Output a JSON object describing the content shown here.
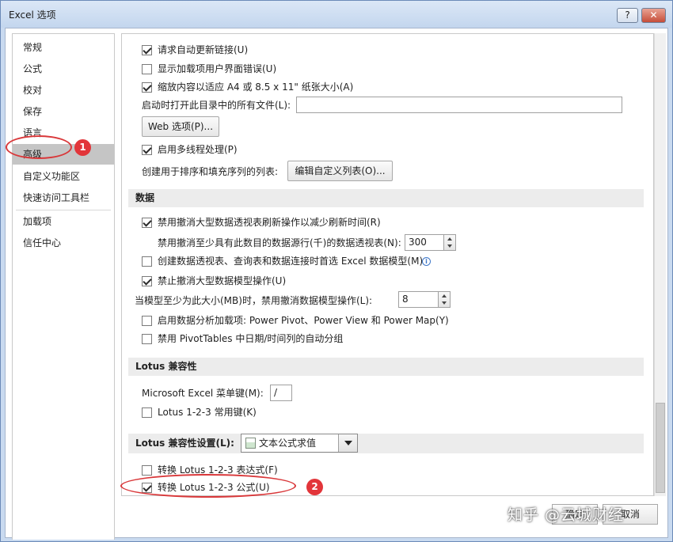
{
  "window": {
    "title": "Excel 选项",
    "help_label": "?",
    "close_label": "✕"
  },
  "nav": {
    "items": [
      "常规",
      "公式",
      "校对",
      "保存",
      "语言",
      "高级",
      "自定义功能区",
      "快速访问工具栏",
      "加载项",
      "信任中心"
    ],
    "selected": "高级"
  },
  "annotations": {
    "num1": "1",
    "num2": "2"
  },
  "general": {
    "auto_update_links": {
      "label": "请求自动更新链接(U)",
      "checked": true
    },
    "addin_ui_errors": {
      "label": "显示加载项用户界面错误(U)",
      "checked": false
    },
    "scale_to_a4": {
      "label": "缩放内容以适应 A4 或 8.5 x 11\" 纸张大小(A)",
      "checked": true
    },
    "startup_open_label": "启动时打开此目录中的所有文件(L):",
    "startup_open_value": "",
    "web_options_label": "Web 选项(P)...",
    "multithread": {
      "label": "启用多线程处理(P)",
      "checked": true
    },
    "sort_fill_label": "创建用于排序和填充序列的列表:",
    "edit_custom_lists_label": "编辑自定义列表(O)..."
  },
  "data_section": {
    "header": "数据",
    "disable_undo_pivot": {
      "label": "禁用撤消大型数据透视表刷新操作以减少刷新时间(R)",
      "checked": true
    },
    "pivot_rows_label": "禁用撤消至少具有此数目的数据源行(千)的数据透视表(N):",
    "pivot_rows_value": "300",
    "create_data_model": {
      "label": "创建数据透视表、查询表和数据连接时首选 Excel 数据模型(M)",
      "checked": false
    },
    "disable_undo_model": {
      "label": "禁止撤消大型数据模型操作(U)",
      "checked": true
    },
    "model_size_label": "当模型至少为此大小(MB)时，禁用撤消数据模型操作(L):",
    "model_size_value": "8",
    "analysis_addins": {
      "label": "启用数据分析加载项: Power Pivot、Power View 和 Power Map(Y)",
      "checked": false
    },
    "pivot_date_group": {
      "label": "禁用 PivotTables 中日期/时间列的自动分组",
      "checked": false
    }
  },
  "lotus_compat": {
    "header": "Lotus 兼容性",
    "menu_key_label": "Microsoft Excel 菜单键(M):",
    "menu_key_value": "/",
    "lotus_nav_keys": {
      "label": "Lotus 1-2-3 常用键(K)",
      "checked": false
    }
  },
  "lotus_settings": {
    "header": "Lotus 兼容性设置(L):",
    "sheet_value": "文本公式求值",
    "transition_expr": {
      "label": "转换 Lotus 1-2-3 表达式(F)",
      "checked": false
    },
    "transition_formula": {
      "label": "转换 Lotus 1-2-3 公式(U)",
      "checked": true
    }
  },
  "footer": {
    "ok_label": "确定",
    "cancel_label": "取消",
    "watermark": "知乎 @云城财经"
  }
}
